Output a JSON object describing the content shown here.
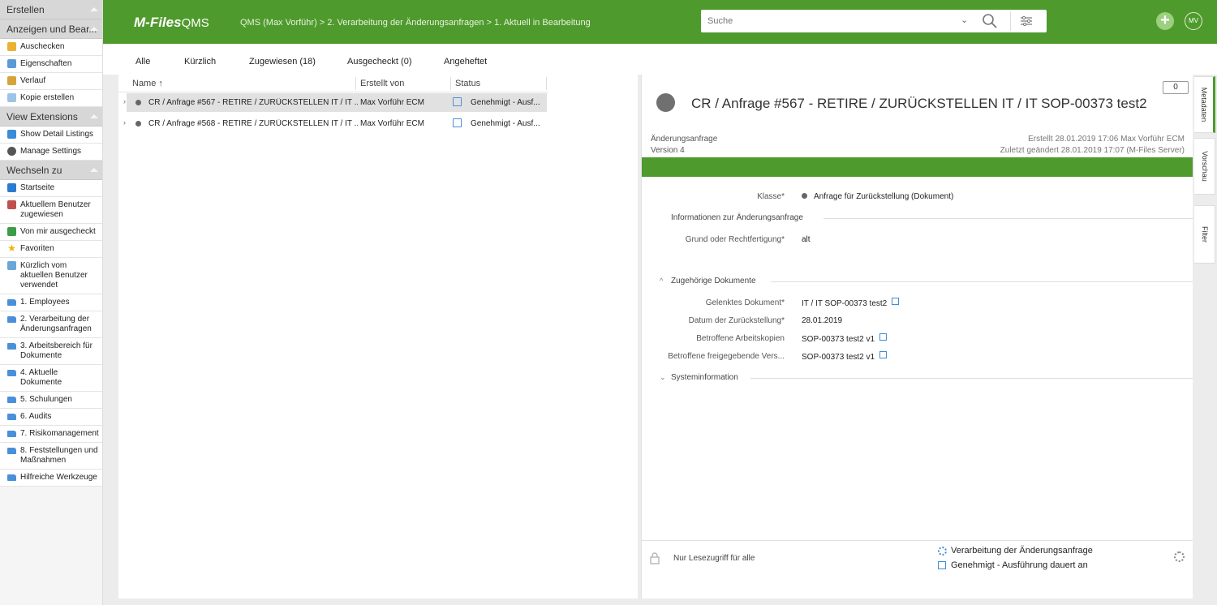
{
  "colors": {
    "brand": "#4f9a2d",
    "accent": "#3b8ed8"
  },
  "sidebar": {
    "create_label": "Erstellen",
    "view_edit_label": "Anzeigen und Bear...",
    "view_edit_items": [
      {
        "label": "Auschecken",
        "icon": "edit-icon"
      },
      {
        "label": "Eigenschaften",
        "icon": "properties-icon"
      },
      {
        "label": "Verlauf",
        "icon": "history-icon"
      },
      {
        "label": "Kopie erstellen",
        "icon": "copy-icon"
      }
    ],
    "view_ext_label": "View Extensions",
    "view_ext_items": [
      {
        "label": "Show Detail Listings",
        "icon": "list-icon"
      },
      {
        "label": "Manage Settings",
        "icon": "gear-icon"
      }
    ],
    "switch_label": "Wechseln zu",
    "switch_items": [
      {
        "label": "Startseite",
        "icon": "home-icon"
      },
      {
        "label": "Aktuellem Benutzer zugewiesen",
        "icon": "assigned-icon"
      },
      {
        "label": "Von mir ausgecheckt",
        "icon": "checked-out-icon"
      },
      {
        "label": "Favoriten",
        "icon": "star-icon"
      },
      {
        "label": "Kürzlich vom aktuellen Benutzer verwendet",
        "icon": "recent-icon"
      },
      {
        "label": "1. Employees",
        "icon": "folder-icon"
      },
      {
        "label": "2. Verarbeitung der Änderungsanfragen",
        "icon": "folder-icon"
      },
      {
        "label": "3. Arbeitsbereich für Dokumente",
        "icon": "folder-icon"
      },
      {
        "label": "4. Aktuelle Dokumente",
        "icon": "folder-icon"
      },
      {
        "label": "5. Schulungen",
        "icon": "folder-icon"
      },
      {
        "label": "6. Audits",
        "icon": "folder-icon"
      },
      {
        "label": "7. Risikomanagement",
        "icon": "folder-icon"
      },
      {
        "label": "8. Feststellungen und Maßnahmen",
        "icon": "folder-icon"
      },
      {
        "label": "Hilfreiche Werkzeuge",
        "icon": "folder-icon"
      }
    ]
  },
  "header": {
    "logo_main": "M-Files",
    "logo_sub": "QMS",
    "breadcrumb": "QMS (Max Vorführ) > 2. Verarbeitung der Änderungsanfragen > 1. Aktuell in Bearbeitung",
    "search_placeholder": "Suche",
    "avatar_initials": "MV"
  },
  "tabs": {
    "all": "Alle",
    "recent": "Kürzlich",
    "assigned": "Zugewiesen (18)",
    "checked_out": "Ausgecheckt (0)",
    "pinned": "Angeheftet"
  },
  "list": {
    "col_name": "Name",
    "col_created_by": "Erstellt von",
    "col_status": "Status",
    "rows": [
      {
        "name": "CR / Anfrage #567 - RETIRE / ZURÜCKSTELLEN IT / IT ...",
        "created_by": "Max Vorführ ECM",
        "status": "Genehmigt - Ausf..."
      },
      {
        "name": "CR / Anfrage #568 - RETIRE / ZURÜCKSTELLEN IT / IT ...",
        "created_by": "Max Vorführ ECM",
        "status": "Genehmigt - Ausf..."
      }
    ]
  },
  "meta": {
    "title": "CR / Anfrage #567 - RETIRE / ZURÜCKSTELLEN IT / IT SOP-00373 test2",
    "comments": "0",
    "class_name": "Änderungsanfrage",
    "version": "Version 4",
    "created": "Erstellt 28.01.2019 17:06 Max Vorführ ECM",
    "modified": "Zuletzt geändert 28.01.2019 17:07 (M-Files Server)",
    "props": {
      "klasse_label": "Klasse",
      "klasse_value": "Anfrage für Zurückstellung (Dokument)",
      "info_section": "Informationen zur Änderungsanfrage",
      "grund_label": "Grund oder Rechtfertigung",
      "grund_value": "alt",
      "related_section": "Zugehörige Dokumente",
      "gelenktes_label": "Gelenktes Dokument",
      "gelenktes_value": "IT / IT SOP-00373 test2",
      "datum_label": "Datum der Zurückstellung",
      "datum_value": "28.01.2019",
      "arbeitskopien_label": "Betroffene Arbeitskopien",
      "arbeitskopien_value": "SOP-00373 test2 v1",
      "freigebende_label": "Betroffene freigegebende Vers...",
      "freigebende_value": "SOP-00373 test2 v1",
      "system_section": "Systeminformation"
    },
    "footer": {
      "permissions": "Nur Lesezugriff für alle",
      "workflow": "Verarbeitung der Änderungsanfrage",
      "state": "Genehmigt - Ausführung dauert an"
    }
  },
  "right_tabs": {
    "metadata": "Metadaten",
    "preview": "Vorschau",
    "filter": "Filter"
  }
}
